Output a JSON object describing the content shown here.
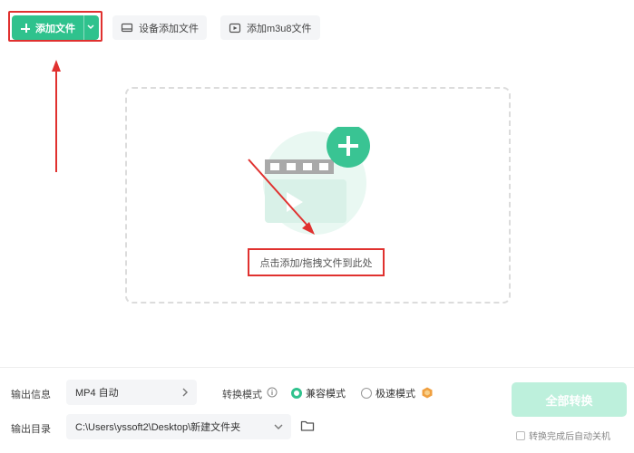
{
  "toolbar": {
    "add_file_label": "添加文件",
    "add_device_label": "设备添加文件",
    "add_m3u8_label": "添加m3u8文件"
  },
  "dropzone": {
    "hint": "点击添加/拖拽文件到此处"
  },
  "bottom": {
    "output_info_label": "输出信息",
    "output_format_value": "MP4 自动",
    "convert_mode_label": "转换模式",
    "mode_compatible_label": "兼容模式",
    "mode_fast_label": "极速模式",
    "mode_selected": "兼容模式",
    "output_dir_label": "输出目录",
    "output_dir_value": "C:\\Users\\yssoft2\\Desktop\\新建文件夹",
    "convert_all_label": "全部转换",
    "shutdown_label": "转换完成后自动关机",
    "shutdown_checked": false
  },
  "colors": {
    "accent": "#2fc28d",
    "annotation": "#e0312f",
    "convert_disabled": "#bdf0dc",
    "vip_badge": "#f0a040"
  }
}
